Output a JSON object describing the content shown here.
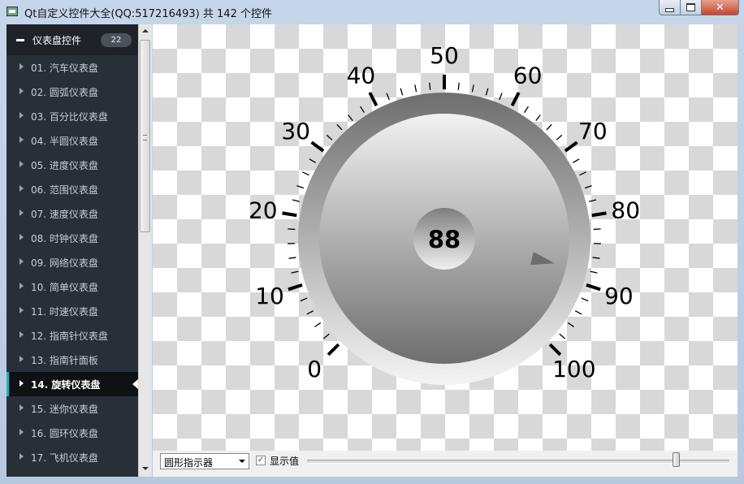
{
  "window": {
    "title": "Qt自定义控件大全(QQ:517216493) 共 142 个控件",
    "close_glyph": "✕"
  },
  "sidebar": {
    "header_label": "仪表盘控件",
    "header_count": "22",
    "items": [
      {
        "label": "01. 汽车仪表盘"
      },
      {
        "label": "02. 圆弧仪表盘"
      },
      {
        "label": "03. 百分比仪表盘"
      },
      {
        "label": "04. 半圆仪表盘"
      },
      {
        "label": "05. 进度仪表盘"
      },
      {
        "label": "06. 范围仪表盘"
      },
      {
        "label": "07. 速度仪表盘"
      },
      {
        "label": "08. 时钟仪表盘"
      },
      {
        "label": "09. 网络仪表盘"
      },
      {
        "label": "10. 简单仪表盘"
      },
      {
        "label": "11. 时速仪表盘"
      },
      {
        "label": "12. 指南针仪表盘"
      },
      {
        "label": "13. 指南针面板"
      },
      {
        "label": "14. 旋转仪表盘",
        "active": true
      },
      {
        "label": "15. 迷你仪表盘"
      },
      {
        "label": "16. 圆环仪表盘"
      },
      {
        "label": "17. 飞机仪表盘"
      }
    ]
  },
  "gauge": {
    "value": "88",
    "value_num": 88,
    "min": 0,
    "max": 100,
    "scale_labels": [
      "0",
      "10",
      "20",
      "30",
      "40",
      "50",
      "60",
      "70",
      "80",
      "90",
      "100"
    ],
    "pointer_style": "triangle"
  },
  "controls": {
    "indicator_select": "圆形指示器",
    "show_value_checked": true,
    "check_glyph": "✓",
    "show_value_label": "显示值",
    "slider_fraction": 0.88
  },
  "colors": {
    "sidebar_bg": "#292f38",
    "active_accent": "#1eb5c9"
  }
}
